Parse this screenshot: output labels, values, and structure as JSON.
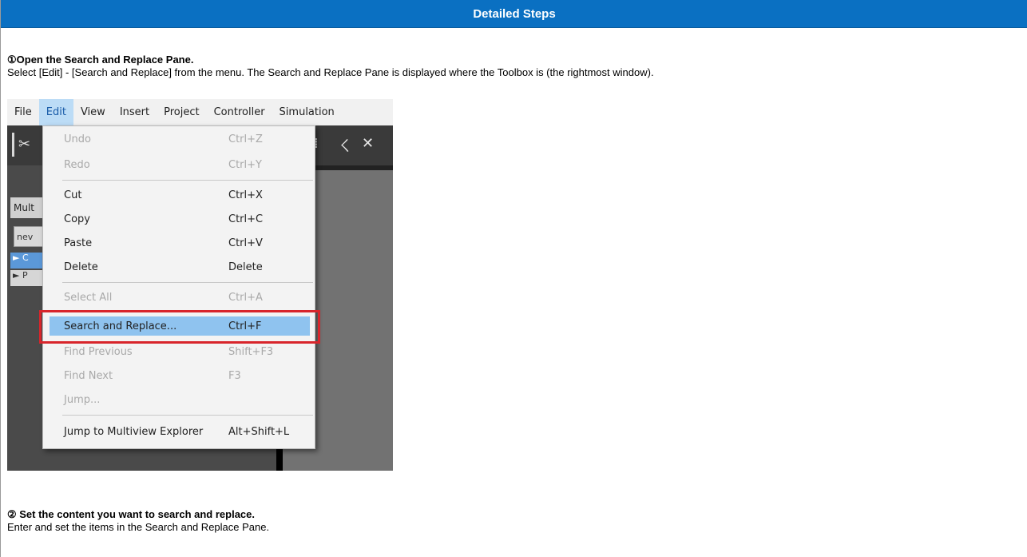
{
  "header": {
    "title": "Detailed Steps"
  },
  "step1": {
    "title": "①Open the Search and Replace Pane.",
    "description": "Select [Edit] - [Search and Replace] from the menu. The Search and Replace Pane is displayed where the Toolbox is (the rightmost window)."
  },
  "screenshot": {
    "menubar": [
      "File",
      "Edit",
      "View",
      "Insert",
      "Project",
      "Controller",
      "Simulation"
    ],
    "left_pane": {
      "tab": "Mult",
      "combo": "nev",
      "tree_item_1": "C",
      "tree_item_2": "P"
    },
    "edit_menu": [
      {
        "label": "Undo",
        "shortcut": "Ctrl+Z"
      },
      {
        "label": "Redo",
        "shortcut": "Ctrl+Y"
      },
      {
        "label": "Cut",
        "shortcut": "Ctrl+X"
      },
      {
        "label": "Copy",
        "shortcut": "Ctrl+C"
      },
      {
        "label": "Paste",
        "shortcut": "Ctrl+V"
      },
      {
        "label": "Delete",
        "shortcut": "Delete"
      },
      {
        "label": "Select All",
        "shortcut": "Ctrl+A"
      },
      {
        "label": "Search and Replace...",
        "shortcut": "Ctrl+F"
      },
      {
        "label": "Find Previous",
        "shortcut": "Shift+F3"
      },
      {
        "label": "Find Next",
        "shortcut": "F3"
      },
      {
        "label": "Jump...",
        "shortcut": ""
      },
      {
        "label": "Jump to Multiview Explorer",
        "shortcut": "Alt+Shift+L"
      }
    ],
    "colors": {
      "highlight": "#8fc3ef",
      "red_box": "#d8252b",
      "header_bg": "#0a70c2"
    }
  },
  "step2": {
    "title": "② Set the content you want to search and replace.",
    "description": "Enter and set the items in the Search and Replace Pane."
  }
}
